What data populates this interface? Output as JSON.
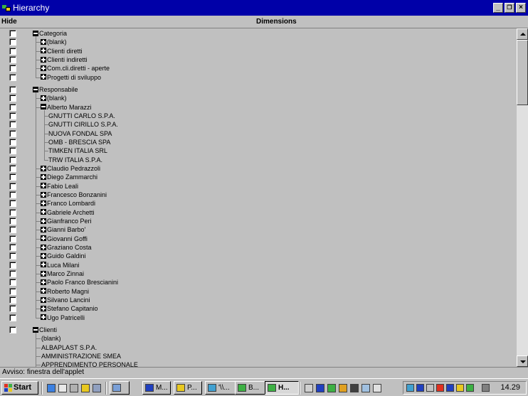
{
  "window": {
    "title": "Hierarchy",
    "min": "_",
    "max": "Б",
    "close": "×"
  },
  "header": {
    "hide": "Hide",
    "dimensions": "Dimensions"
  },
  "tree": [
    {
      "type": "root",
      "label": "Categoria",
      "expanded": true
    },
    {
      "type": "child",
      "label": "(blank)",
      "toggle": "plus"
    },
    {
      "type": "child",
      "label": "Clienti diretti",
      "toggle": "plus"
    },
    {
      "type": "child",
      "label": "Clienti indiretti",
      "toggle": "plus"
    },
    {
      "type": "child",
      "label": "Com.cli.diretti - aperte",
      "toggle": "plus"
    },
    {
      "type": "child",
      "label": "Progetti di sviluppo",
      "toggle": "plus",
      "last": true
    },
    {
      "type": "gap"
    },
    {
      "type": "root",
      "label": "Responsabile",
      "expanded": true
    },
    {
      "type": "child",
      "label": "(blank)",
      "toggle": "plus"
    },
    {
      "type": "child",
      "label": "Alberto Marazzi",
      "toggle": "minus"
    },
    {
      "type": "leaf2",
      "label": "GNUTTI CARLO S.P.A."
    },
    {
      "type": "leaf2",
      "label": "GNUTTI CIRILLO S.P.A."
    },
    {
      "type": "leaf2",
      "label": "NUOVA FONDAL SPA"
    },
    {
      "type": "leaf2",
      "label": "OMB - BRESCIA SPA"
    },
    {
      "type": "leaf2",
      "label": "TIMKEN ITALIA SRL"
    },
    {
      "type": "leaf2",
      "label": "TRW ITALIA S.P.A.",
      "last": true
    },
    {
      "type": "child",
      "label": "Claudio Pedrazzoli",
      "toggle": "plus"
    },
    {
      "type": "child",
      "label": "Diego Zammarchi",
      "toggle": "plus"
    },
    {
      "type": "child",
      "label": "Fabio Leali",
      "toggle": "plus"
    },
    {
      "type": "child",
      "label": "Francesco Bonzanini",
      "toggle": "plus"
    },
    {
      "type": "child",
      "label": "Franco Lombardi",
      "toggle": "plus"
    },
    {
      "type": "child",
      "label": "Gabriele Archetti",
      "toggle": "plus"
    },
    {
      "type": "child",
      "label": "Gianfranco Peri",
      "toggle": "plus"
    },
    {
      "type": "child",
      "label": "Gianni Barbo'",
      "toggle": "plus"
    },
    {
      "type": "child",
      "label": "Giovanni Goffi",
      "toggle": "plus"
    },
    {
      "type": "child",
      "label": "Graziano Costa",
      "toggle": "plus"
    },
    {
      "type": "child",
      "label": "Guido Galdini",
      "toggle": "plus"
    },
    {
      "type": "child",
      "label": "Luca Milani",
      "toggle": "plus"
    },
    {
      "type": "child",
      "label": "Marco Zinnai",
      "toggle": "plus"
    },
    {
      "type": "child",
      "label": "Paolo Franco Brescianini",
      "toggle": "plus"
    },
    {
      "type": "child",
      "label": "Roberto Magni",
      "toggle": "plus"
    },
    {
      "type": "child",
      "label": "Silvano Lancini",
      "toggle": "plus"
    },
    {
      "type": "child",
      "label": "Stefano Capitanio",
      "toggle": "plus"
    },
    {
      "type": "child",
      "label": "Ugo Patricelli",
      "toggle": "plus",
      "last": true
    },
    {
      "type": "gap"
    },
    {
      "type": "root",
      "label": "Clienti",
      "expanded": true
    },
    {
      "type": "leaf1",
      "label": "(blank)"
    },
    {
      "type": "leaf1",
      "label": "ALBAPLAST S.P.A."
    },
    {
      "type": "leaf1",
      "label": "AMMINISTRAZIONE SMEA"
    },
    {
      "type": "leaf1",
      "label": "APPRENDIMENTO PERSONALE"
    }
  ],
  "status": "Avviso: finestra dell'applet",
  "taskbar": {
    "start": "Start",
    "tasks": [
      {
        "label": "",
        "icon_color": "#7aa0d8"
      },
      {
        "label": "M...",
        "icon_color": "#2040c0"
      },
      {
        "label": "P...",
        "icon_color": "#e8c820"
      },
      {
        "label": "'\\\\...",
        "icon_color": "#40a0d0"
      },
      {
        "label": "B...",
        "icon_color": "#3cb043"
      },
      {
        "label": "H...",
        "icon_color": "#3cb043",
        "active": true
      }
    ],
    "clock": "14.29"
  },
  "colors": {
    "titlebar": "#0000a8",
    "face": "#c0c0c0"
  },
  "icons": [
    "hierarchy-app-icon",
    "minimize-icon",
    "maximize-icon",
    "close-icon",
    "windows-logo-icon",
    "scroll-up-arrow-icon",
    "scroll-down-arrow-icon"
  ]
}
